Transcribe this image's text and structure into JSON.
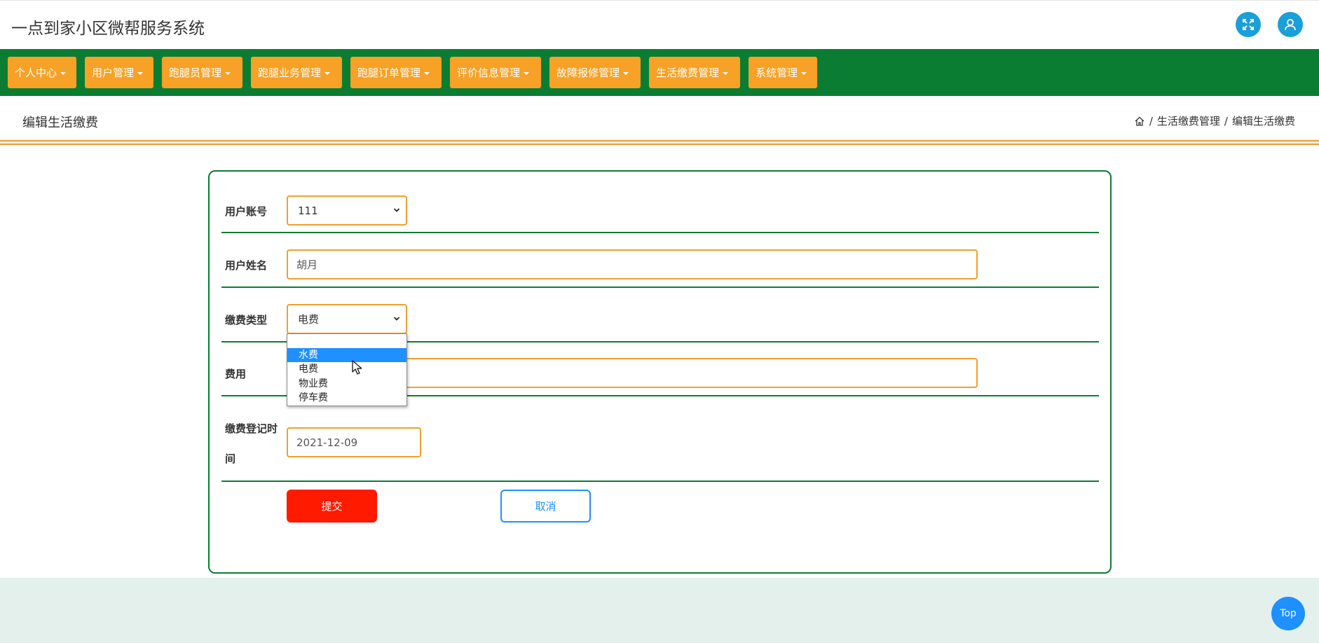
{
  "app": {
    "title": "一点到家小区微帮服务系统"
  },
  "header_icons": {
    "fullscreen": "fullscreen-icon",
    "user": "user-icon"
  },
  "nav": {
    "items": [
      {
        "label": "个人中心"
      },
      {
        "label": "用户管理"
      },
      {
        "label": "跑腿员管理"
      },
      {
        "label": "跑腿业务管理"
      },
      {
        "label": "跑腿订单管理"
      },
      {
        "label": "评价信息管理"
      },
      {
        "label": "故障报修管理"
      },
      {
        "label": "生活缴费管理"
      },
      {
        "label": "系统管理"
      }
    ]
  },
  "page": {
    "title": "编辑生活缴费",
    "breadcrumb": [
      "生活缴费管理",
      "编辑生活缴费"
    ],
    "separator": "/"
  },
  "form": {
    "account": {
      "label": "用户账号",
      "value": "111"
    },
    "name": {
      "label": "用户姓名",
      "value": "胡月"
    },
    "fee_type": {
      "label": "缴费类型",
      "value": "电费",
      "options": [
        "水费",
        "电费",
        "物业费",
        "停车费"
      ],
      "highlighted": "水费"
    },
    "cost": {
      "label": "费用",
      "value": ""
    },
    "reg_time": {
      "label_line1": "缴费登记时",
      "label_line2": "间",
      "value": "2021-12-09"
    },
    "submit_label": "提交",
    "cancel_label": "取消"
  },
  "scroll_top": {
    "label": "Top"
  },
  "colors": {
    "nav_bg": "#0a7d33",
    "nav_item": "#f7a126",
    "accent_orange": "#f0a030",
    "submit": "#ff1a00",
    "cancel": "#1e90ff",
    "icon_btn": "#1a9fd8",
    "footer_bg": "#e3f0ec"
  }
}
